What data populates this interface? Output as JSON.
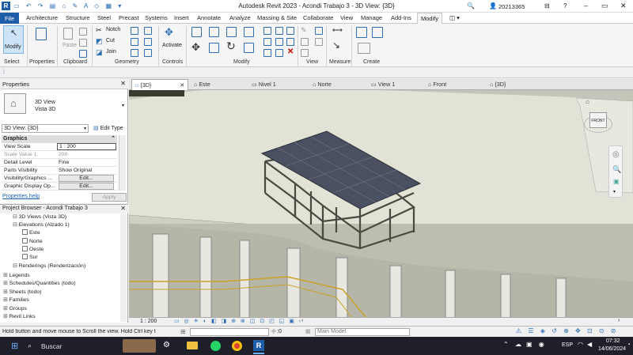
{
  "window": {
    "title": "Autodesk Revit 2023 - Acondi Trabajo 3 - 3D View: {3D}",
    "user": "20213365"
  },
  "ribbon_tabs": [
    "File",
    "Architecture",
    "Structure",
    "Steel",
    "Precast",
    "Systems",
    "Insert",
    "Annotate",
    "Analyze",
    "Massing & Site",
    "Collaborate",
    "View",
    "Manage",
    "Add-Ins",
    "Modify"
  ],
  "ribbon": {
    "modify_label": "Modify",
    "select_label": "Select",
    "properties_label": "Properties",
    "paste_label": "Paste",
    "clipboard_label": "Clipboard",
    "notch_label": "Notch",
    "cut_label": "Cut",
    "join_label": "Join",
    "geometry_label": "Geometry",
    "activate_label": "Activate",
    "controls_label": "Controls",
    "modify_group_label": "Modify",
    "view_label": "View",
    "measure_label": "Measure",
    "create_label": "Create"
  },
  "properties": {
    "header": "Properties",
    "type_line1": "3D View",
    "type_line2": "Vista 3D",
    "selector": "3D View: {3D}",
    "edit_type": "Edit Type",
    "section": "Graphics",
    "rows": [
      {
        "name": "View Scale",
        "value": "1 : 200"
      },
      {
        "name": "Scale Value    1:",
        "value": "200"
      },
      {
        "name": "Detail Level",
        "value": "Fine"
      },
      {
        "name": "Parts Visibility",
        "value": "Show Original"
      },
      {
        "name": "Visibility/Graphics ...",
        "value": "Edit..."
      },
      {
        "name": "Graphic Display Op...",
        "value": "Edit..."
      }
    ],
    "help_link": "Properties help",
    "apply": "Apply"
  },
  "project_browser": {
    "header": "Project Browser - Acondi Trabajo 3",
    "items": [
      {
        "label": "3D Views (Vista 3D)",
        "depth": 1
      },
      {
        "label": "Elevations (Alzado 1)",
        "depth": 1
      },
      {
        "label": "Este",
        "depth": 2
      },
      {
        "label": "Norte",
        "depth": 2
      },
      {
        "label": "Oeste",
        "depth": 2
      },
      {
        "label": "Sur",
        "depth": 2
      },
      {
        "label": "Renderings (Renderización)",
        "depth": 1
      },
      {
        "label": "Legends",
        "depth": 0
      },
      {
        "label": "Schedules/Quantities (todo)",
        "depth": 0
      },
      {
        "label": "Sheets (todo)",
        "depth": 0
      },
      {
        "label": "Families",
        "depth": 0
      },
      {
        "label": "Groups",
        "depth": 0
      },
      {
        "label": "Revit Links",
        "depth": 0
      }
    ]
  },
  "view_tabs": [
    "{3D}",
    "Este",
    "Nivel 1",
    "Norte",
    "View 1",
    "Front",
    "{3D}"
  ],
  "viewcube_label": "FRONT",
  "view_control": {
    "scale": "1 : 200"
  },
  "status": {
    "message": "Hold button and move mouse to Scroll the view. Hold Ctrl key t",
    "selection_count": ":0",
    "model": "Main Model"
  },
  "taskbar": {
    "search": "Buscar",
    "lang": "ESP",
    "time": "07:32",
    "date": "14/06/2024"
  },
  "colors": {
    "accent": "#1e5ea8",
    "viewport_bg": "#c4c4b8",
    "taskbar": "#1f1f2a"
  }
}
